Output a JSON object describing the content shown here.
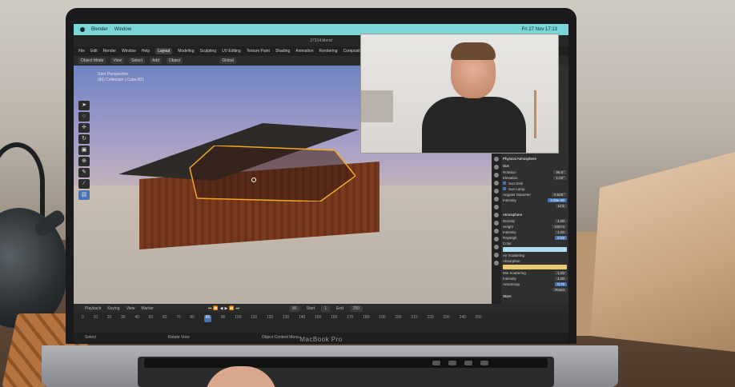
{
  "menubar": {
    "app": "Blender",
    "items": [
      "Window"
    ],
    "clock": "Fri 27 Nov 17:13"
  },
  "blender": {
    "file_title": "27314.blend",
    "menu": [
      "File",
      "Edit",
      "Render",
      "Window",
      "Help"
    ],
    "workspaces": [
      "Layout",
      "Modeling",
      "Sculpting",
      "UV Editing",
      "Texture Paint",
      "Shading",
      "Animation",
      "Rendering",
      "Compositing"
    ],
    "active_workspace": "Layout",
    "header": {
      "mode": "Object Mode",
      "view": "View",
      "select": "Select",
      "add": "Add",
      "object": "Object",
      "transform": "Global"
    },
    "viewport_info": {
      "line1": "User Perspective",
      "line2": "(86) Collection | Cube.001"
    }
  },
  "properties": {
    "section1": "Physical Atmosphere",
    "sun_head": "Sun",
    "sun_rows": [
      {
        "label": "Rotation",
        "value": "96.5°"
      },
      {
        "label": "Elevation",
        "value": "1.00°"
      }
    ],
    "checks": [
      "Sun Disk",
      "Sun Lamp"
    ],
    "angular": {
      "label": "Angular Diameter",
      "value": "0.526°"
    },
    "intensity_hl": {
      "label": "Intensity",
      "value": "3.00e-00"
    },
    "link": "Link",
    "section2": "Atmosphere",
    "atm_rows": [
      {
        "label": "Density",
        "value": "1.00"
      },
      {
        "label": "Height",
        "value": "100 m"
      },
      {
        "label": "Intensity",
        "value": "1.00"
      },
      {
        "label": "Rayleigh",
        "value": "0.50"
      }
    ],
    "color_rows": [
      "Color",
      "Air Scattering",
      "Absorption"
    ],
    "mie_rows": [
      {
        "label": "Mie Scattering",
        "value": "1.00"
      },
      {
        "label": "Intensity",
        "value": "1.00"
      },
      {
        "label": "Anisotropy",
        "value": "0.70"
      }
    ],
    "reset": "Reset",
    "stars": "Stars",
    "colors": {
      "accent": "#4772b3",
      "color_swatch": "#aee0f0",
      "absorption_swatch": "#e8c970"
    }
  },
  "timeline": {
    "playback": "Playback",
    "keying": "Keying",
    "view": "View",
    "marker": "Marker",
    "current_frame": "86",
    "start_label": "Start",
    "start": "1",
    "end_label": "End",
    "end": "250",
    "ruler": [
      "0",
      "10",
      "20",
      "30",
      "40",
      "50",
      "60",
      "70",
      "80",
      "90",
      "100",
      "110",
      "120",
      "130",
      "140",
      "150",
      "160",
      "170",
      "180",
      "190",
      "200",
      "210",
      "220",
      "230",
      "240",
      "250"
    ],
    "ruler_current": "86"
  },
  "status": {
    "select": "Select",
    "rotate": "Rotate View",
    "context": "Object Context Menu"
  },
  "device": {
    "label": "MacBook Pro"
  }
}
